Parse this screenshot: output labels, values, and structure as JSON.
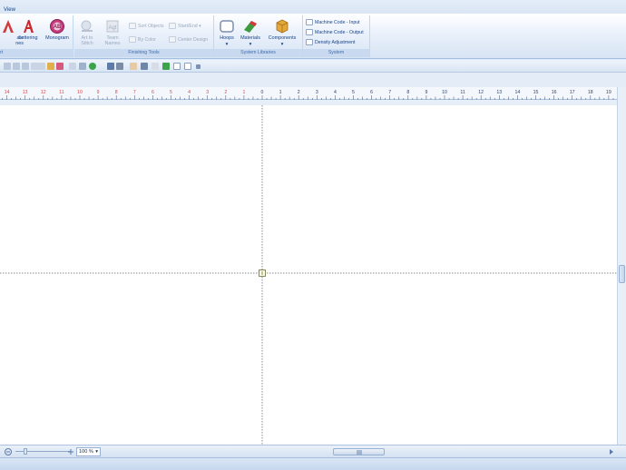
{
  "ribbon": {
    "tab_label": "View",
    "groups": {
      "create": {
        "title": "rt",
        "buttons": {
          "first_label": "ate\nnes",
          "lettering": "Lettering",
          "monogram": "Monogram"
        }
      },
      "finishing_tools": {
        "title": "Finishing Tools",
        "art_to_stitch": "Art to\nStitch",
        "team_names": "Team\nNames",
        "sort_objects": "Sort Objects",
        "start_end": "Start/End",
        "by_color": "By Color",
        "center_design": "Center Design"
      },
      "system_libraries": {
        "title": "System Libraries",
        "hoops": "Hoops",
        "materials": "Materials",
        "components": "Components"
      },
      "system": {
        "title": "System",
        "machine_code_input": "Machine Code - Input",
        "machine_code_output": "Machine Code - Output",
        "density_adjustment": "Density Adjustment"
      }
    }
  },
  "ruler": {
    "left_labels": [
      "14",
      "13",
      "12",
      "11",
      "10",
      "9",
      "8",
      "7",
      "6",
      "5",
      "4",
      "3",
      "2",
      "1"
    ],
    "right_labels": [
      "0",
      "1",
      "2",
      "3",
      "4",
      "5",
      "6",
      "7",
      "8",
      "9",
      "10",
      "11",
      "12",
      "13",
      "14",
      "15",
      "16",
      "17",
      "18",
      "19"
    ]
  },
  "zoom": {
    "value": "100 %"
  },
  "colors": {
    "ruler_negative": "#d8474a",
    "ruler_positive": "#2b3f66",
    "ribbon_text": "#15428b"
  }
}
